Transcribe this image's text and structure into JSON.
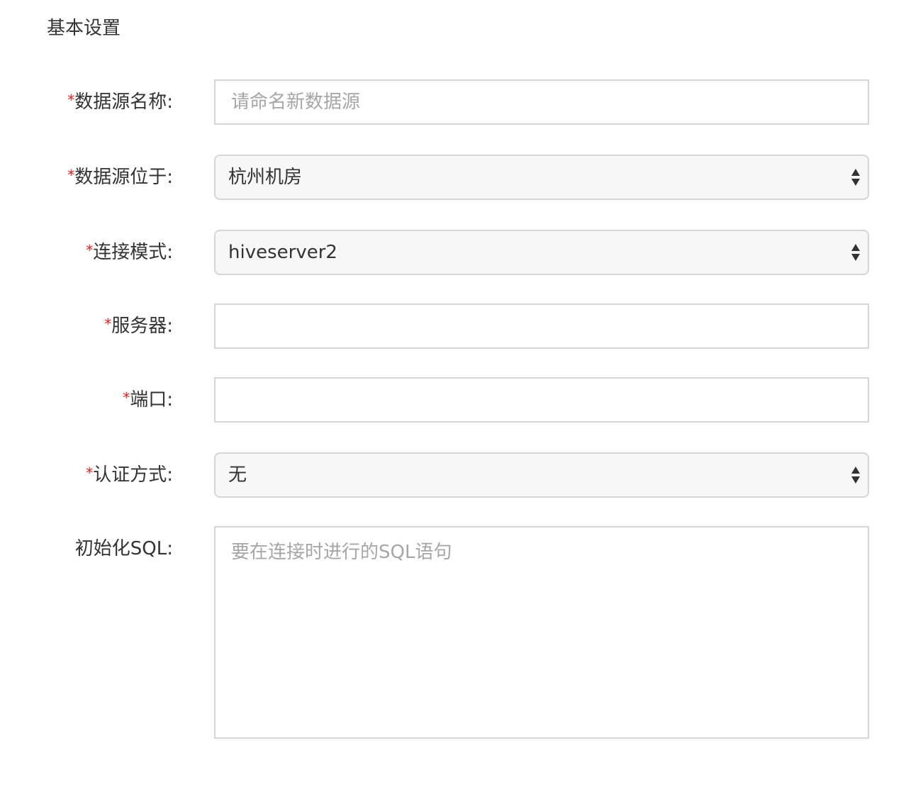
{
  "section": {
    "title": "基本设置"
  },
  "required_mark": "*",
  "fields": {
    "name": {
      "label": "数据源名称:",
      "value": "",
      "placeholder": "请命名新数据源"
    },
    "location": {
      "label": "数据源位于:",
      "selected": "杭州机房"
    },
    "mode": {
      "label": "连接模式:",
      "selected": "hiveserver2"
    },
    "server": {
      "label": "服务器:",
      "value": ""
    },
    "port": {
      "label": "端口:",
      "value": ""
    },
    "auth": {
      "label": "认证方式:",
      "selected": "无"
    },
    "init_sql": {
      "label": "初始化SQL:",
      "value": "",
      "placeholder": "要在连接时进行的SQL语句"
    }
  },
  "icons": {
    "select_arrow": "sort-arrows-icon"
  },
  "colors": {
    "required": "#e02020",
    "border": "#d6d6d6",
    "select_bg": "#f7f7f7",
    "placeholder": "#a6a6a6",
    "text": "#333333"
  }
}
